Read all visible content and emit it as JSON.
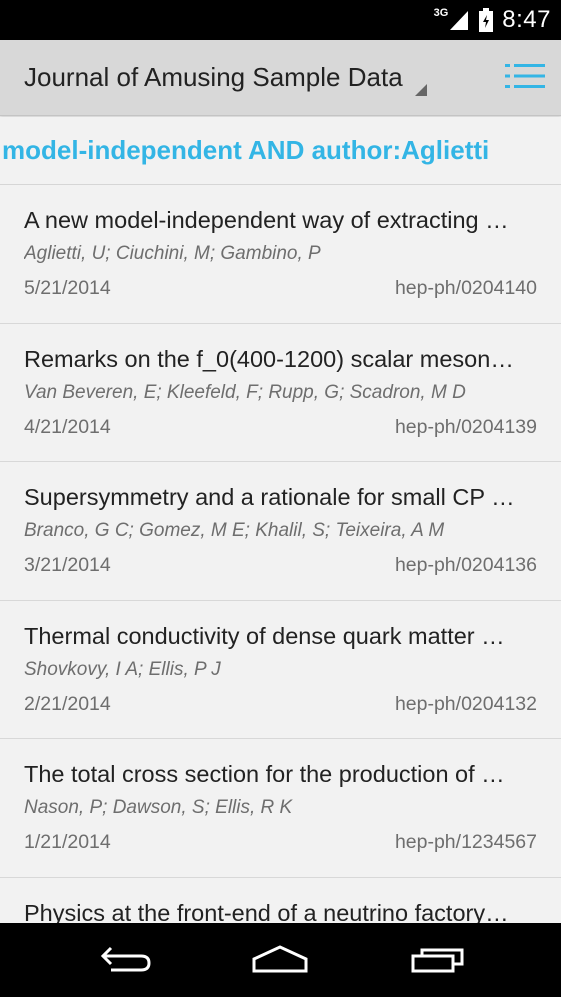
{
  "status_bar": {
    "network_type": "3G",
    "time": "8:47",
    "icons": [
      "signal-icon",
      "battery-icon"
    ]
  },
  "action_bar": {
    "title": "Journal of Amusing Sample Data",
    "menu_icon": "list-menu-icon",
    "accent_color": "#33b5e5"
  },
  "search": {
    "query": "model-independent AND author:Aglietti"
  },
  "results": [
    {
      "title": "A new model-independent way of extracting …",
      "authors": "Aglietti, U; Ciuchini, M; Gambino, P",
      "date": "5/21/2014",
      "id": "hep-ph/0204140"
    },
    {
      "title": "Remarks on the f_0(400-1200) scalar meson…",
      "authors": "Van Beveren, E; Kleefeld, F; Rupp, G; Scadron, M D",
      "date": "4/21/2014",
      "id": "hep-ph/0204139"
    },
    {
      "title": "Supersymmetry and a rationale for small CP …",
      "authors": "Branco, G C; Gomez, M E; Khalil, S; Teixeira, A M",
      "date": "3/21/2014",
      "id": "hep-ph/0204136"
    },
    {
      "title": "Thermal conductivity of dense quark matter …",
      "authors": "Shovkovy, I A; Ellis, P J",
      "date": "2/21/2014",
      "id": "hep-ph/0204132"
    },
    {
      "title": "The total cross section for the production of …",
      "authors": "Nason, P; Dawson, S; Ellis, R K",
      "date": "1/21/2014",
      "id": "hep-ph/1234567"
    },
    {
      "title": "Physics at the front-end of a neutrino factory…",
      "authors": "",
      "date": "",
      "id": ""
    }
  ],
  "nav_bar": {
    "icons": [
      "back-icon",
      "home-icon",
      "recents-icon"
    ]
  }
}
